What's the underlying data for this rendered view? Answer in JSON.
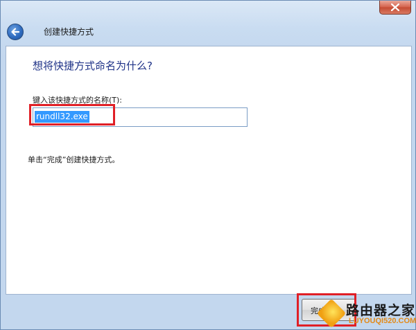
{
  "window": {
    "title": "创建快捷方式"
  },
  "page": {
    "question": "想将快捷方式命名为什么?",
    "input_label": "键入该快捷方式的名称(T):",
    "input_value": "rundll32.exe",
    "hint": "单击“完成”创建快捷方式。"
  },
  "buttons": {
    "finish_label": "完成(F)"
  },
  "watermark": {
    "name": "路由器之家",
    "url": "LUYOUQI520.COM"
  },
  "icons": {
    "back": "back-arrow-icon",
    "close": "close-icon"
  },
  "colors": {
    "question_text": "#1e3287",
    "highlight_box": "#e01f26",
    "selection": "#3399ff"
  }
}
